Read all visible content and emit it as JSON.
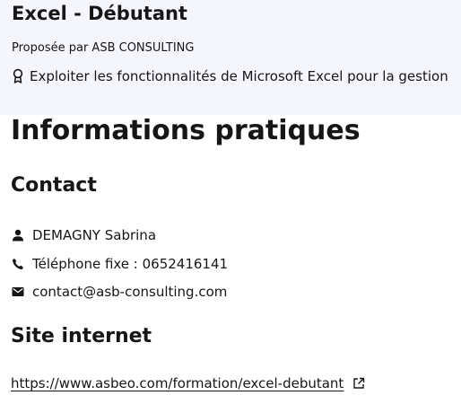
{
  "header": {
    "title": "Excel - Débutant",
    "provider": "Proposée par ASB CONSULTING",
    "objective_icon": "award-ribbon-icon",
    "objective": "Exploiter les fonctionnalités de Microsoft Excel pour la gestion"
  },
  "practical": {
    "title": "Informations pratiques"
  },
  "contact": {
    "title": "Contact",
    "name_icon": "user-icon",
    "name": "DEMAGNY Sabrina",
    "phone_icon": "phone-icon",
    "phone": "Téléphone fixe : 0652416141",
    "email_icon": "mail-icon",
    "email": "contact@asb-consulting.com"
  },
  "website": {
    "title": "Site internet",
    "url": "https://www.asbeo.com/formation/excel-debutant",
    "link_icon": "external-link-icon"
  },
  "colors": {
    "header_background": "#f5f5fe",
    "text": "#161616"
  }
}
